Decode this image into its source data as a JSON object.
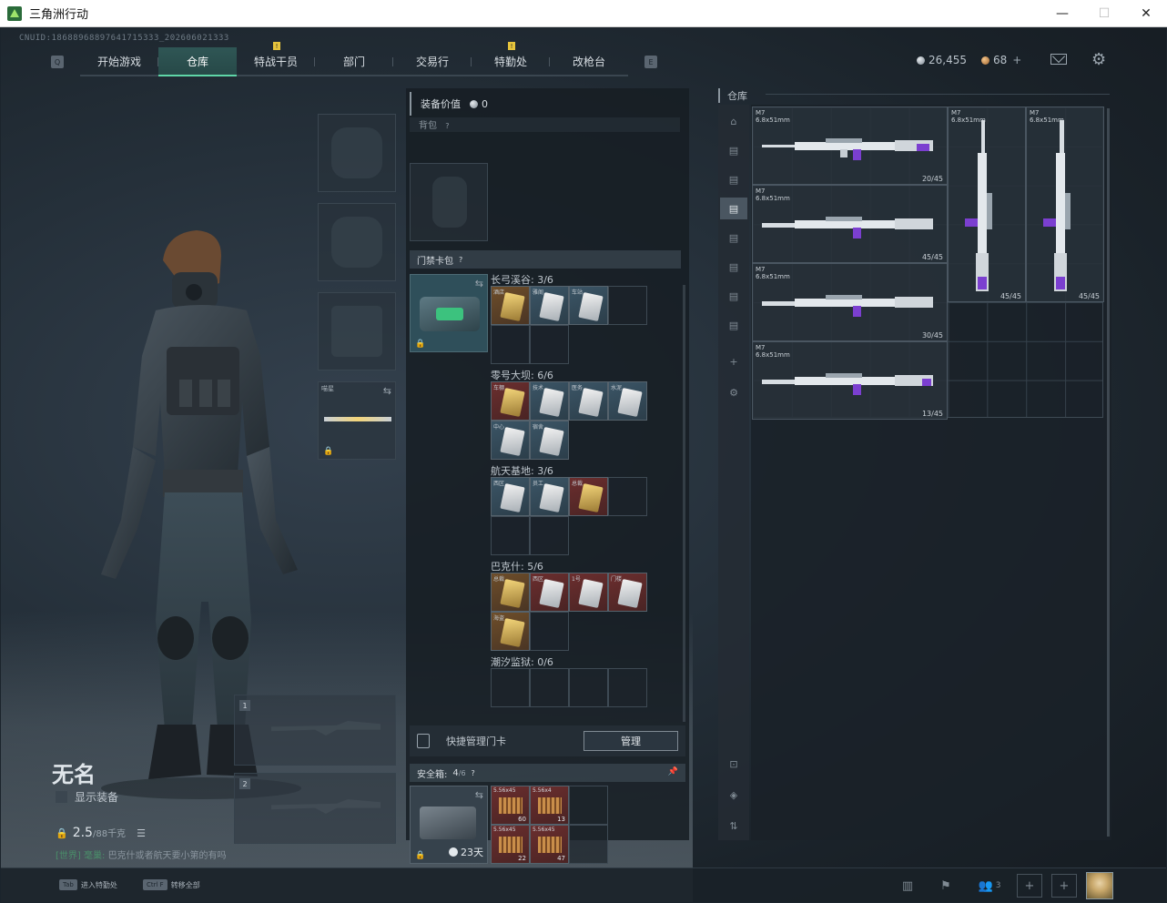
{
  "window": {
    "title": "三角洲行动",
    "min": "—",
    "max": "☐",
    "close": "✕"
  },
  "uid": "CNUID:18688968897641715333_202606021333",
  "nav": {
    "left_key": "Q",
    "right_key": "E",
    "tabs": [
      {
        "label": "开始游戏",
        "active": false,
        "badge": false
      },
      {
        "label": "仓库",
        "active": true,
        "badge": false
      },
      {
        "label": "特战干员",
        "active": false,
        "badge": true
      },
      {
        "label": "部门",
        "active": false,
        "badge": false
      },
      {
        "label": "交易行",
        "active": false,
        "badge": false
      },
      {
        "label": "特勤处",
        "active": false,
        "badge": true
      },
      {
        "label": "改枪台",
        "active": false,
        "badge": false
      }
    ]
  },
  "currency": {
    "silver": "26,455",
    "gold": "68",
    "plus": "+"
  },
  "character": {
    "name": "无名",
    "show_equip": "显示装备",
    "weight": "2.5",
    "weight_max": "/88千克",
    "chat_channel": "[世界]",
    "chat_user": "毫巢:",
    "chat_msg": "巴克什或者航天要小第的有吗"
  },
  "slots": {
    "melee_label": "喵星",
    "weapon1": "1",
    "weapon2": "2"
  },
  "middle": {
    "value_label": "装备价值",
    "value": "0",
    "backpack": "背包",
    "help": "?",
    "card_pack": "门禁卡包",
    "maps": [
      {
        "name": "长弓溪谷: 3/6"
      },
      {
        "name": "零号大坝: 6/6"
      },
      {
        "name": "航天基地: 3/6"
      },
      {
        "name": "巴克什: 5/6"
      },
      {
        "name": "潮汐监狱: 0/6"
      }
    ],
    "quick_manage": "快捷管理门卡",
    "manage_btn": "管理",
    "safe_label": "安全箱:",
    "safe_count": "4",
    "safe_total": "/6",
    "safe_time": "23天",
    "ammo": [
      {
        "tag": "5.56x45",
        "count": "60"
      },
      {
        "tag": "5.56x4",
        "count": "13"
      },
      {
        "tag": "5.56x45",
        "count": "22"
      },
      {
        "tag": "5.56x45",
        "count": "47"
      }
    ]
  },
  "stash": {
    "label": "仓库",
    "guns": [
      {
        "name": "M7",
        "caliber": "6.8x51mm",
        "ammo": "20/45"
      },
      {
        "name": "M7",
        "caliber": "6.8x51mm",
        "ammo": "45/45"
      },
      {
        "name": "M7",
        "caliber": "6.8x51mm",
        "ammo": "30/45"
      },
      {
        "name": "M7",
        "caliber": "6.8x51mm",
        "ammo": "13/45"
      },
      {
        "name": "M7",
        "caliber": "6.8x51mm",
        "ammo": "45/45"
      },
      {
        "name": "M7",
        "caliber": "6.8x51mm",
        "ammo": "45/45"
      }
    ]
  },
  "hints": [
    {
      "key": "Tab",
      "label": "进入特勤处"
    },
    {
      "key": "Ctrl F",
      "label": "转移全部"
    }
  ],
  "friends_count": "3"
}
